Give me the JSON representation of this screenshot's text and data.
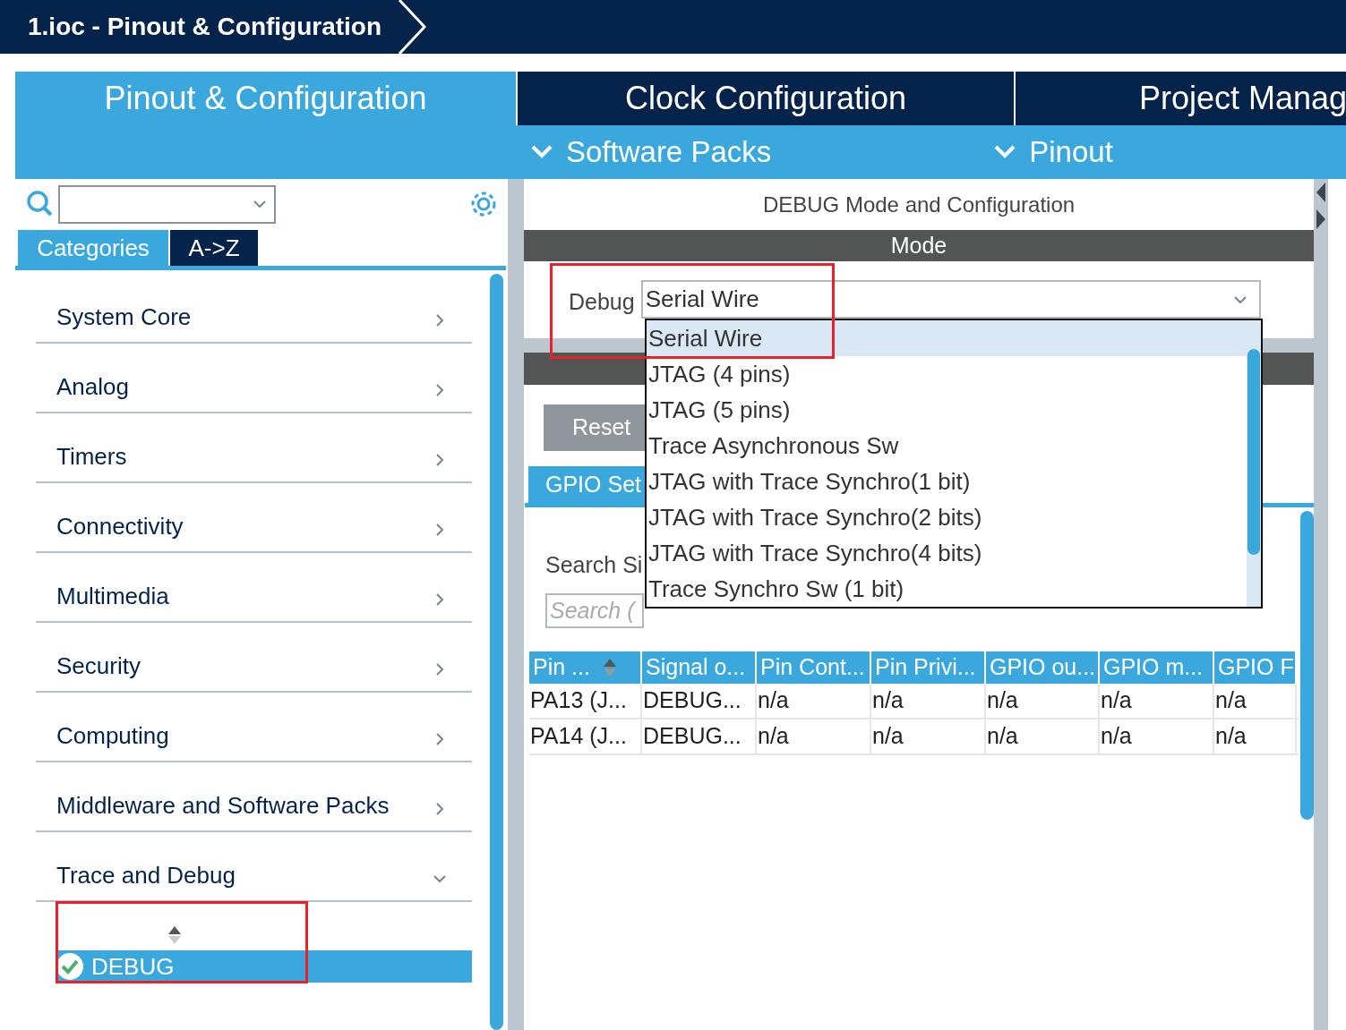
{
  "window": {
    "title": "1.ioc - Pinout & Configuration"
  },
  "main_tabs": [
    {
      "label": "Pinout & Configuration",
      "selected": true
    },
    {
      "label": "Clock Configuration",
      "selected": false
    },
    {
      "label": "Project Manag",
      "selected": false
    }
  ],
  "sub_menus": [
    "Software Packs",
    "Pinout"
  ],
  "sidebar": {
    "view_tabs": [
      {
        "label": "Categories",
        "selected": true
      },
      {
        "label": "A->Z",
        "selected": false
      }
    ],
    "categories": [
      {
        "label": "System Core",
        "expanded": false
      },
      {
        "label": "Analog",
        "expanded": false
      },
      {
        "label": "Timers",
        "expanded": false
      },
      {
        "label": "Connectivity",
        "expanded": false
      },
      {
        "label": "Multimedia",
        "expanded": false
      },
      {
        "label": "Security",
        "expanded": false
      },
      {
        "label": "Computing",
        "expanded": false
      },
      {
        "label": "Middleware and Software Packs",
        "expanded": false
      },
      {
        "label": "Trace and Debug",
        "expanded": true,
        "children": [
          {
            "label": "DEBUG",
            "selected": true,
            "checked": true
          }
        ]
      }
    ]
  },
  "panel": {
    "title": "DEBUG Mode and Configuration",
    "mode_header": "Mode",
    "debug_label": "Debug",
    "debug_value": "Serial Wire",
    "dropdown_options": [
      {
        "label": "Serial Wire",
        "selected": true
      },
      {
        "label": "JTAG (4 pins)",
        "selected": false
      },
      {
        "label": "JTAG (5 pins)",
        "selected": false
      },
      {
        "label": "Trace Asynchronous Sw",
        "selected": false
      },
      {
        "label": "JTAG with Trace Synchro(1 bit)",
        "selected": false
      },
      {
        "label": "JTAG with Trace Synchro(2 bits)",
        "selected": false
      },
      {
        "label": "JTAG with Trace Synchro(4 bits)",
        "selected": false
      },
      {
        "label": "Trace Synchro Sw (1 bit)",
        "selected": false
      }
    ],
    "reset_button": "Reset",
    "settings_tab": "GPIO Set",
    "search_label": "Search Si",
    "search_placeholder": "Search (",
    "table": {
      "columns": [
        "Pin ...",
        "Signal o...",
        "Pin Cont...",
        "Pin Privi...",
        "GPIO ou...",
        "GPIO m...",
        "GPIO F"
      ],
      "rows": [
        [
          "PA13 (J...",
          "DEBUG...",
          "n/a",
          "n/a",
          "n/a",
          "n/a",
          "n/a"
        ],
        [
          "PA14 (J...",
          "DEBUG...",
          "n/a",
          "n/a",
          "n/a",
          "n/a",
          "n/a"
        ]
      ]
    }
  }
}
